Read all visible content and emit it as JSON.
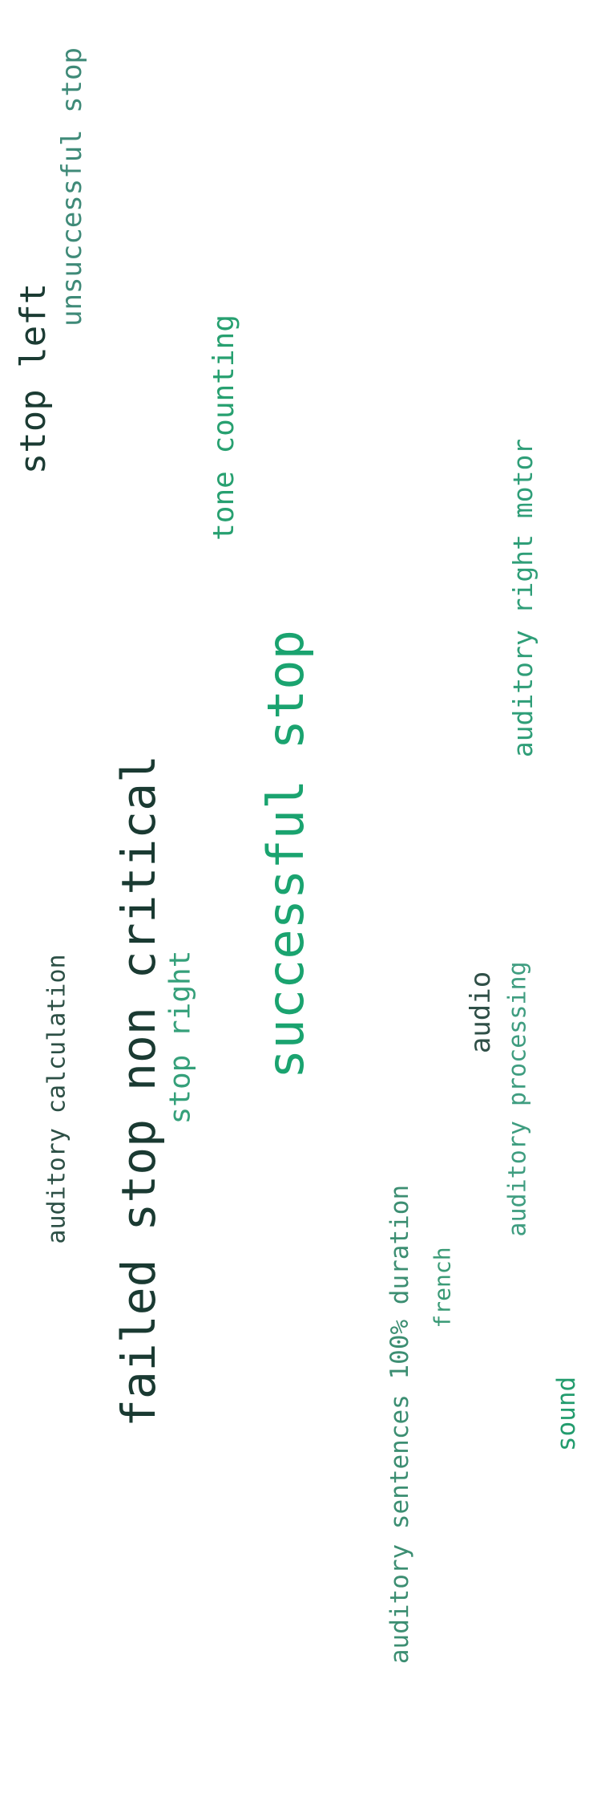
{
  "words": [
    {
      "id": "unsuccessful-stop",
      "text": "unsuccessful stop",
      "color": "#3f8a78"
    },
    {
      "id": "stop-left",
      "text": "stop left",
      "color": "#1b3b33"
    },
    {
      "id": "tone-counting",
      "text": "tone counting",
      "color": "#27a070"
    },
    {
      "id": "auditory-right-motor",
      "text": "auditory right motor",
      "color": "#2f9e78"
    },
    {
      "id": "successful-stop",
      "text": "successful stop",
      "color": "#1aa36f"
    },
    {
      "id": "failed-stop-non-critical",
      "text": "failed stop non critical",
      "color": "#1a3a32"
    },
    {
      "id": "auditory-calculation",
      "text": "auditory calculation",
      "color": "#2c4f45"
    },
    {
      "id": "stop-right",
      "text": "stop right",
      "color": "#35a07a"
    },
    {
      "id": "audio",
      "text": "audio",
      "color": "#2f4f47"
    },
    {
      "id": "auditory-processing",
      "text": "auditory processing",
      "color": "#3f9d80"
    },
    {
      "id": "auditory-sentences-100-duration",
      "text": "auditory sentences 100% duration",
      "color": "#3c8e72"
    },
    {
      "id": "french",
      "text": "french",
      "color": "#3a9a76"
    },
    {
      "id": "sound",
      "text": "sound",
      "color": "#239c6e"
    }
  ]
}
